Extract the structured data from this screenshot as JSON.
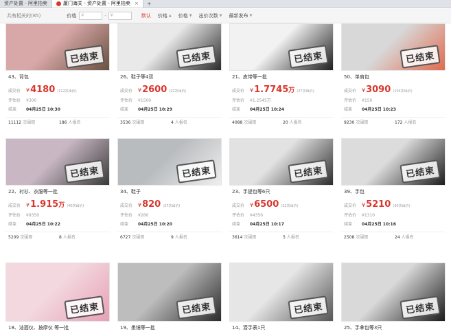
{
  "tabs": [
    {
      "label": "资产处置 - 阿里拍卖",
      "active": false
    },
    {
      "label": "厦门海关 - 资产处置 - 阿里拍卖",
      "active": true
    }
  ],
  "filter": {
    "total_label": "共有相关的(85)",
    "price_label": "价格",
    "min_placeholder": "¥",
    "max_placeholder": "¥",
    "dash": "-",
    "sorts": [
      {
        "label": "默认",
        "active": true
      },
      {
        "label": "价格",
        "active": false
      },
      {
        "label": "价格",
        "active": false
      },
      {
        "label": "出价次数",
        "active": false
      },
      {
        "label": "最新发布",
        "active": false
      }
    ]
  },
  "labels": {
    "deal": "成交价",
    "eval": "评估价",
    "end": "结束",
    "views": "次围观",
    "signups": "人报名",
    "stamp": "已结束",
    "yen": "¥"
  },
  "lots": [
    {
      "title": "43、背包",
      "price": "4180",
      "unit": "",
      "bids": "(112次出价)",
      "eval": "¥300",
      "end": "04月25日 10:30",
      "views": "11112",
      "signups": "186",
      "colors": [
        "#d8a8a8",
        "#6a5040"
      ]
    },
    {
      "title": "26、鞋子等4双",
      "price": "2600",
      "unit": "",
      "bids": "(22次出价)",
      "eval": "¥1500",
      "end": "04月25日 10:29",
      "views": "3536",
      "signups": "4",
      "colors": [
        "#e9e9e9",
        "#2b2b2b"
      ]
    },
    {
      "title": "21、皮带等一批",
      "price": "1.7745",
      "unit": "万",
      "bids": "(27次出价)",
      "eval": "¥1.2545万",
      "end": "04月25日 10:24",
      "views": "4088",
      "signups": "20",
      "colors": [
        "#f2f2f2",
        "#1e1e1e"
      ]
    },
    {
      "title": "50、单肩包",
      "price": "3090",
      "unit": "",
      "bids": "(104次出价)",
      "eval": "¥150",
      "end": "04月25日 10:23",
      "views": "9230",
      "signups": "172",
      "colors": [
        "#d8d8d8",
        "#e06a4e"
      ]
    },
    {
      "title": "22、衬衫、衣服等一批",
      "price": "1.915",
      "unit": "万",
      "bids": "(40次出价)",
      "eval": "¥9350",
      "end": "04月25日 10:22",
      "views": "5209",
      "signups": "8",
      "colors": [
        "#c9b8c4",
        "#3a3a3a"
      ]
    },
    {
      "title": "34、鞋子",
      "price": "820",
      "unit": "",
      "bids": "(27次出价)",
      "eval": "¥280",
      "end": "04月25日 10:20",
      "views": "6727",
      "signups": "9",
      "colors": [
        "#b9bcbf",
        "#eeeeee"
      ]
    },
    {
      "title": "23、手提包等6只",
      "price": "6500",
      "unit": "",
      "bids": "(22次出价)",
      "eval": "¥4350",
      "end": "04月25日 10:17",
      "views": "3614",
      "signups": "5",
      "colors": [
        "#e2e2e2",
        "#2c2c2c"
      ]
    },
    {
      "title": "39、手包",
      "price": "5210",
      "unit": "",
      "bids": "(30次出价)",
      "eval": "¥1310",
      "end": "04月25日 10:16",
      "views": "2508",
      "signups": "24",
      "colors": [
        "#dcdcdc",
        "#1d1d1d"
      ]
    },
    {
      "title": "18、洁面仪、按摩仪 等一批",
      "colors": [
        "#f3d9df",
        "#e7a0b5"
      ]
    },
    {
      "title": "19、墨镜等一批",
      "colors": [
        "#bdbdbd",
        "#2a2a2a"
      ]
    },
    {
      "title": "14、潜手表1只",
      "colors": [
        "#e6e6e6",
        "#555555"
      ]
    },
    {
      "title": "25、手拿包等3只",
      "colors": [
        "#d9d9d9",
        "#1b1b1b"
      ]
    }
  ]
}
